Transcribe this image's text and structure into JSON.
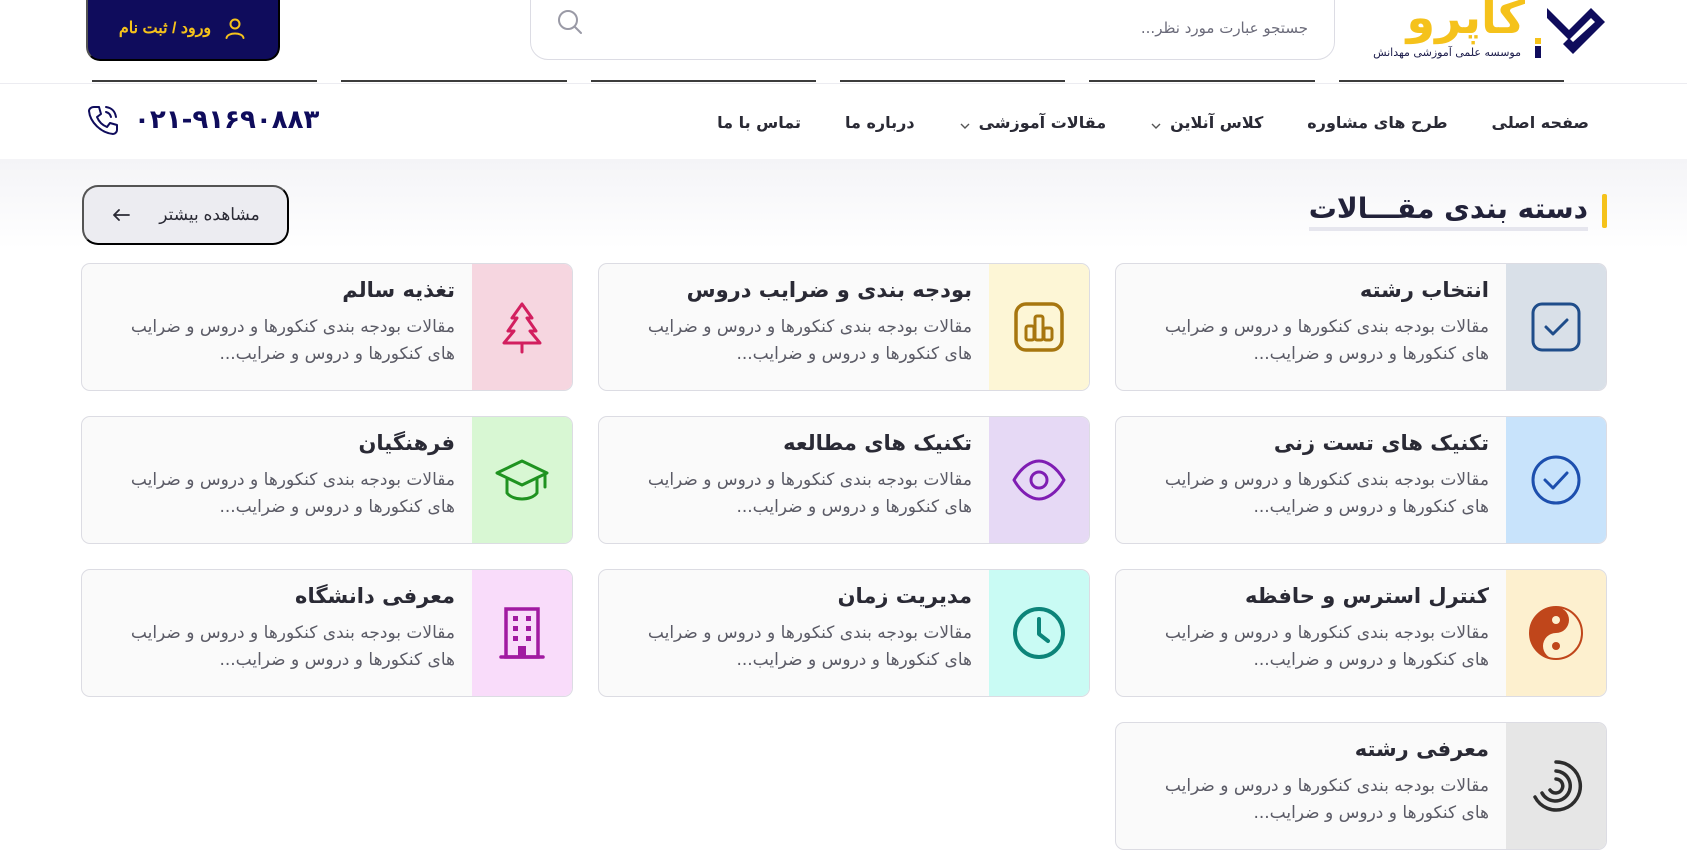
{
  "header": {
    "logo": {
      "wordmark": "کاپرو",
      "subtitle": "موسسه علمی آموزشی مهدانش"
    },
    "search": {
      "placeholder": "جستجو عبارت مورد نظر..."
    },
    "login_label": "ورود / ثبت نام"
  },
  "nav": {
    "items": [
      {
        "label": "صفحه اصلی",
        "has_dropdown": false
      },
      {
        "label": "طرح های مشاوره",
        "has_dropdown": false
      },
      {
        "label": "کلاس آنلاین",
        "has_dropdown": true
      },
      {
        "label": "مقالات آموزشی",
        "has_dropdown": true
      },
      {
        "label": "درباره ما",
        "has_dropdown": false
      },
      {
        "label": "تماس با ما",
        "has_dropdown": false
      }
    ],
    "phone": "۰۲۱-۹۱۶۹۰۸۸۳"
  },
  "section": {
    "title": "دسته بندی مقـــالات",
    "more_label": "مشاهده بیشتر"
  },
  "categories": [
    {
      "title": "انتخاب رشته",
      "desc": "مقالات بودجه بندی کنکورها و دروس و ضرایب های کنکورها و دروس و ضرایب...",
      "icon": "checkbox-icon",
      "bg": "#d9e0e8",
      "color": "#1f4d8a"
    },
    {
      "title": "بودجه بندی و ضرایب دروس",
      "desc": "مقالات بودجه بندی کنکورها و دروس و ضرایب های کنکورها و دروس و ضرایب...",
      "icon": "chart-bars-icon",
      "bg": "#fdf6d6",
      "color": "#a7760f"
    },
    {
      "title": "تغذیه سالم",
      "desc": "مقالات بودجه بندی کنکورها و دروس و ضرایب های کنکورها و دروس و ضرایب...",
      "icon": "tree-icon",
      "bg": "#f6d6e0",
      "color": "#d21f5f"
    },
    {
      "title": "تکنیک های تست زنی",
      "desc": "مقالات بودجه بندی کنکورها و دروس و ضرایب های کنکورها و دروس و ضرایب...",
      "icon": "check-circle-icon",
      "bg": "#c8e3fb",
      "color": "#1d4fae"
    },
    {
      "title": "تکنیک های مطالعه",
      "desc": "مقالات بودجه بندی کنکورها و دروس و ضرایب های کنکورها و دروس و ضرایب...",
      "icon": "eye-icon",
      "bg": "#e6d9f5",
      "color": "#7f1db3"
    },
    {
      "title": "فرهنگیان",
      "desc": "مقالات بودجه بندی کنکورها و دروس و ضرایب های کنکورها و دروس و ضرایب...",
      "icon": "graduation-cap-icon",
      "bg": "#d8f7d3",
      "color": "#1f9320"
    },
    {
      "title": "کنترل استرس و حافظه",
      "desc": "مقالات بودجه بندی کنکورها و دروس و ضرایب های کنکورها و دروس و ضرایب...",
      "icon": "yin-yang-icon",
      "bg": "#fdf0cf",
      "color": "#c0461b"
    },
    {
      "title": "مدیریت زمان",
      "desc": "مقالات بودجه بندی کنکورها و دروس و ضرایب های کنکورها و دروس و ضرایب...",
      "icon": "clock-icon",
      "bg": "#c9fbf4",
      "color": "#0c8479"
    },
    {
      "title": "معرفی دانشگاه",
      "desc": "مقالات بودجه بندی کنکورها و دروس و ضرایب های کنکورها و دروس و ضرایب...",
      "icon": "building-icon",
      "bg": "#f9dcfa",
      "color": "#a11aa1"
    },
    {
      "title": "معرفی رشته",
      "desc": "مقالات بودجه بندی کنکورها و دروس و ضرایب های کنکورها و دروس و ضرایب...",
      "icon": "spiral-icon",
      "bg": "#e6e6e6",
      "color": "#2d2d2d"
    }
  ]
}
